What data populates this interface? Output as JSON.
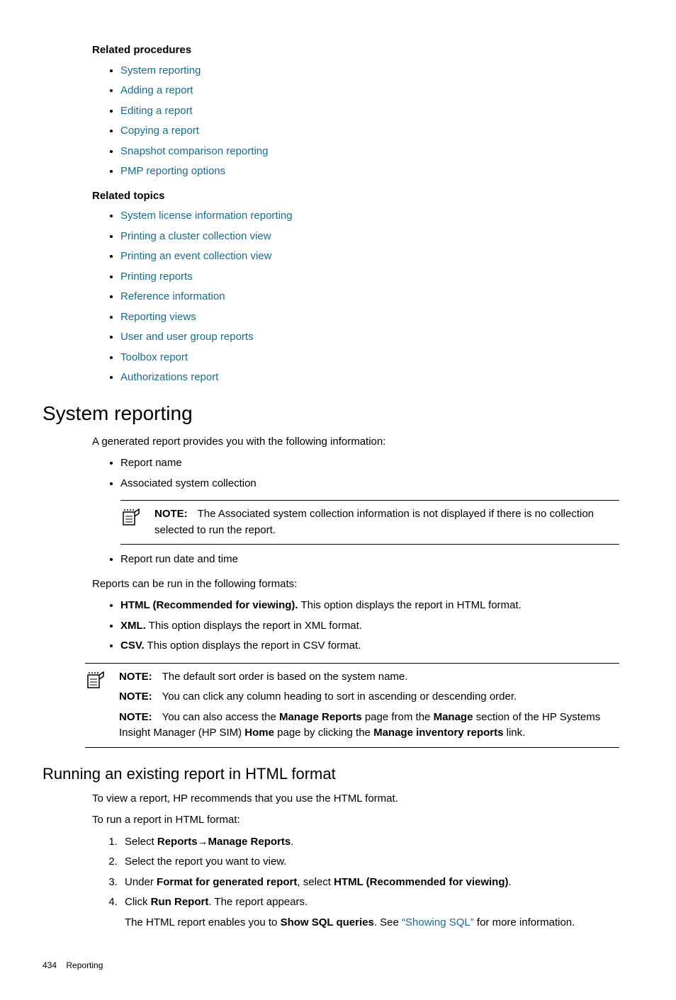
{
  "headings": {
    "relatedProcedures": "Related procedures",
    "relatedTopics": "Related topics",
    "systemReporting": "System reporting",
    "runningExisting": "Running an existing report in HTML format"
  },
  "relatedProceduresLinks": {
    "0": "System reporting",
    "1": "Adding a report",
    "2": "Editing a report",
    "3": "Copying a report",
    "4": "Snapshot comparison reporting",
    "5": "PMP reporting options"
  },
  "relatedTopicsLinks": {
    "0": "System license information reporting",
    "1": "Printing a cluster collection view",
    "2": "Printing an event collection view",
    "3": "Printing reports",
    "4": "Reference information",
    "5": "Reporting views",
    "6": "User and user group reports",
    "7": "Toolbox report",
    "8": "Authorizations report"
  },
  "systemReportingIntro": "A generated report provides you with the following information:",
  "reportInfo": {
    "0": "Report name",
    "1": "Associated system collection",
    "2": "Report run date and time"
  },
  "note1": {
    "label": "NOTE:",
    "text": "The Associated system collection information is not displayed if there is no collection selected to run the report."
  },
  "formatsIntro": "Reports can be run in the following formats:",
  "formats": {
    "0": {
      "bold": "HTML (Recommended for viewing).",
      "rest": " This option displays the report in HTML format."
    },
    "1": {
      "bold": "XML.",
      "rest": " This option displays the report in XML format."
    },
    "2": {
      "bold": "CSV.",
      "rest": " This option displays the report in CSV format."
    }
  },
  "note2": {
    "label": "NOTE:",
    "r0": "The default sort order is based on the system name.",
    "r1": "You can click any column heading to sort in ascending or descending order.",
    "r2a": "You can also access the ",
    "r2b": "Manage Reports",
    "r2c": " page from the ",
    "r2d": "Manage",
    "r2e": " section of the HP Systems Insight Manager (HP SIM) ",
    "r2f": "Home",
    "r2g": " page by clicking the ",
    "r2h": "Manage inventory reports",
    "r2i": " link."
  },
  "runningIntro1": "To view a report, HP recommends that you use the HTML format.",
  "runningIntro2": "To run a report in HTML format:",
  "steps": {
    "s1a": "Select ",
    "s1b": "Reports",
    "s1arrow": "→",
    "s1c": "Manage Reports",
    "s1d": ".",
    "s2": "Select the report you want to view.",
    "s3a": "Under ",
    "s3b": "Format for generated report",
    "s3c": ", select ",
    "s3d": "HTML (Recommended for viewing)",
    "s3e": ".",
    "s4a": "Click ",
    "s4b": "Run Report",
    "s4c": ". The report appears.",
    "s4note_a": "The HTML report enables you to ",
    "s4note_b": "Show SQL queries",
    "s4note_c": ". See ",
    "s4note_link": "“Showing SQL”",
    "s4note_d": " for more information."
  },
  "footer": {
    "page": "434",
    "section": "Reporting"
  }
}
